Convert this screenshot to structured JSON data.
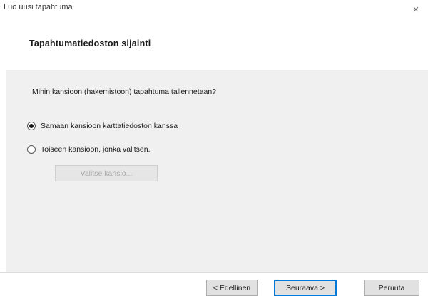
{
  "window": {
    "title": "Luo uusi tapahtuma",
    "close_glyph": "×"
  },
  "header": {
    "title": "Tapahtumatiedoston sijainti"
  },
  "content": {
    "question": "Mihin kansioon (hakemistoon) tapahtuma tallennetaan?",
    "options": [
      {
        "label": "Samaan kansioon karttatiedoston kanssa",
        "selected": true
      },
      {
        "label": "Toiseen kansioon, jonka valitsen.",
        "selected": false
      }
    ],
    "choose_folder_label": "Valitse kansio...",
    "choose_folder_enabled": false
  },
  "footer": {
    "back_label": "< Edellinen",
    "next_label": "Seuraava >",
    "cancel_label": "Peruuta"
  },
  "colors": {
    "accent": "#0078d7",
    "content_bg": "#f0f0f0",
    "disabled_text": "#a8a8a8"
  }
}
